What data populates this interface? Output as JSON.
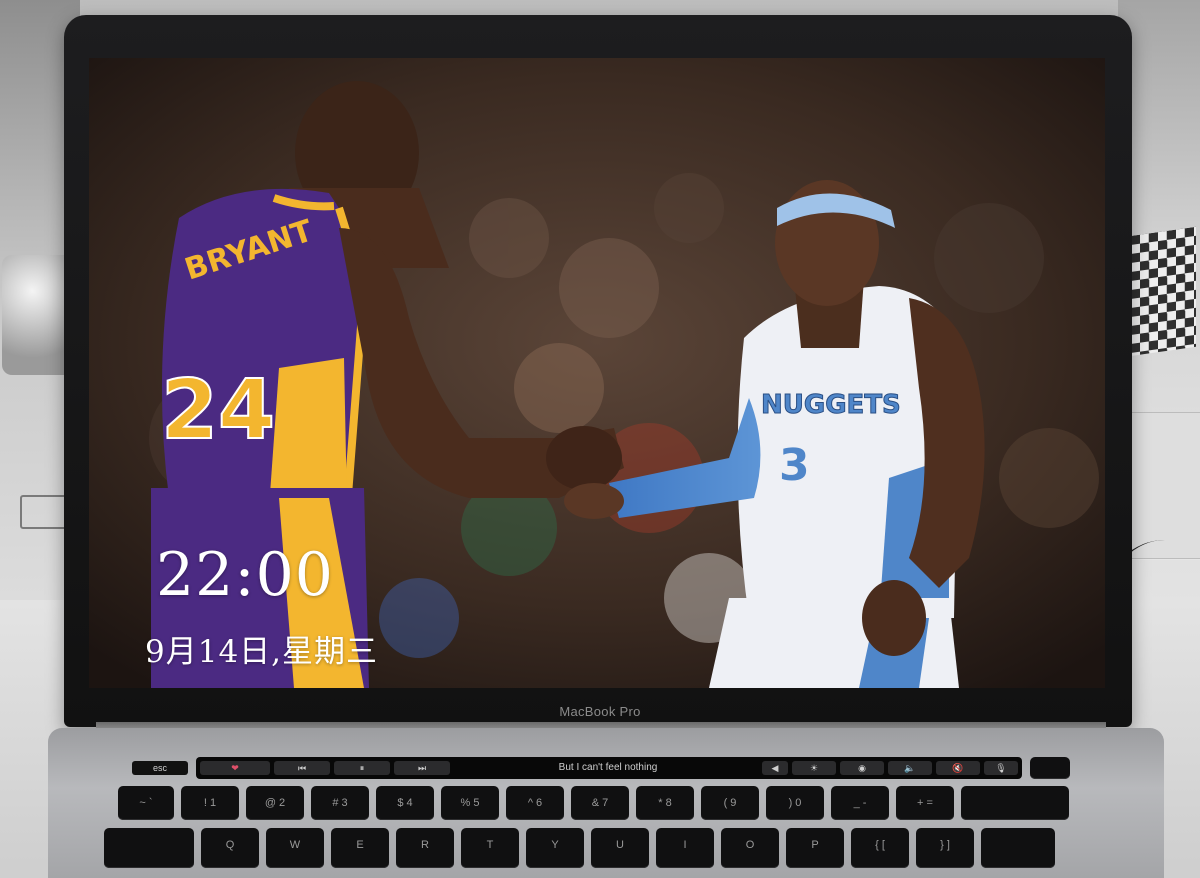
{
  "lock_screen": {
    "time": "22:00",
    "date": "9月14日,星期三"
  },
  "wallpaper": {
    "left_player": {
      "name_on_jersey": "BRYANT",
      "number": "24"
    },
    "right_player": {
      "team_on_jersey": "NUGGETS",
      "number": "3"
    }
  },
  "laptop": {
    "brand_label": "MacBook Pro",
    "touch_bar": {
      "now_playing": "But I can't feel nothing",
      "controls": [
        "esc",
        "❤",
        "⏮",
        "⏸",
        "⏭",
        "◀",
        "☀",
        "◉",
        "🔈",
        "🔇",
        "🎙"
      ]
    },
    "keyboard": {
      "number_row": [
        "~ `",
        "! 1",
        "@ 2",
        "# 3",
        "$ 4",
        "% 5",
        "^ 6",
        "& 7",
        "* 8",
        "( 9",
        ") 0",
        "_ -",
        "+ ="
      ],
      "letter_row": [
        "Q",
        "W",
        "E",
        "R",
        "T",
        "Y",
        "U",
        "I",
        "O",
        "P",
        "{ [",
        "} ]"
      ]
    }
  },
  "colors": {
    "lakers_purple": "#4b2a82",
    "lakers_gold": "#f3b62f",
    "nuggets_white": "#eef0f5",
    "nuggets_blue": "#4f86c9",
    "bezel": "#141414",
    "clock_text": "#ffffff"
  }
}
